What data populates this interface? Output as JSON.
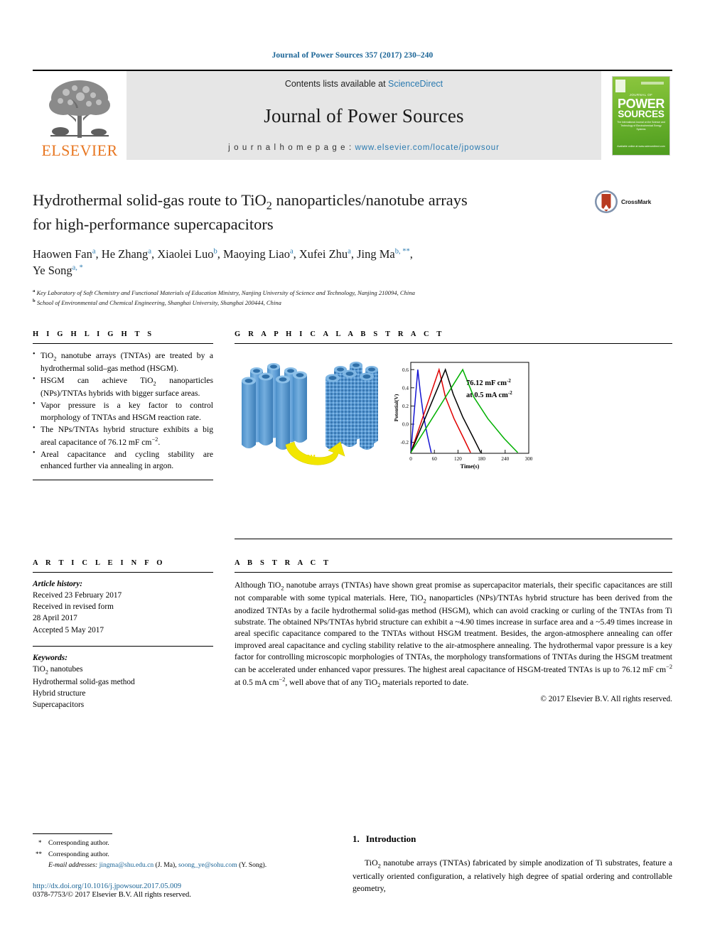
{
  "running_head": "Journal of Power Sources 357 (2017) 230–240",
  "masthead": {
    "publisher": "ELSEVIER",
    "contents_prefix": "Contents lists available at ",
    "contents_link": "ScienceDirect",
    "journal_name": "Journal of Power Sources",
    "homepage_prefix": "j o u r n a l   h o m e p a g e :  ",
    "homepage_url": "www.elsevier.com/locate/jpowsour",
    "cover": {
      "supertitle": "JOURNAL OF",
      "line1": "POWER",
      "line2": "SOURCES",
      "subtitle": "The International Journal on the Science and Technology of Electrochemical Energy Systems",
      "footer": "Available online at\nwww.sciencedirect.com"
    }
  },
  "article": {
    "title": "Hydrothermal solid-gas route to TiO2 nanoparticles/nanotube arrays for high-performance supercapacitors",
    "title_line1_a": "Hydrothermal solid-gas route to TiO",
    "title_line1_sub": "2",
    "title_line1_b": " nanoparticles/nanotube arrays",
    "title_line2": "for high-performance supercapacitors",
    "crossmark_label": "CrossMark",
    "authors": [
      {
        "name": "Haowen Fan",
        "marks": "a",
        "sep": ", "
      },
      {
        "name": "He Zhang",
        "marks": "a",
        "sep": ", "
      },
      {
        "name": "Xiaolei Luo",
        "marks": "b",
        "sep": ", "
      },
      {
        "name": "Maoying Liao",
        "marks": "a",
        "sep": ", "
      },
      {
        "name": "Xufei Zhu",
        "marks": "a",
        "sep": ", "
      },
      {
        "name": "Jing Ma",
        "marks": "b, **",
        "sep": ", "
      },
      {
        "name": "Ye Song",
        "marks": "a, *",
        "sep": ""
      }
    ],
    "affiliations": [
      {
        "mark": "a",
        "text": "Key Laboratory of Soft Chemistry and Functional Materials of Education Ministry, Nanjing University of Science and Technology, Nanjing 210094, China"
      },
      {
        "mark": "b",
        "text": "School of Environmental and Chemical Engineering, Shanghai University, Shanghai 200444, China"
      }
    ]
  },
  "highlights": {
    "heading": "H I G H L I G H T S",
    "items": [
      "TiO2 nanotube arrays (TNTAs) are treated by a hydrothermal solid–gas method (HSGM).",
      "HSGM can achieve TiO2 nanoparticles (NPs)/TNTAs hybrids with bigger surface areas.",
      "Vapor pressure is a key factor to control morphology of TNTAs and HSGM reaction rate.",
      "The NPs/TNTAs hybrid structure exhibits a big areal capacitance of 76.12 mF cm−2.",
      "Areal capacitance and cycling stability are enhanced further via annealing in argon."
    ]
  },
  "graphical_abstract": {
    "heading": "G R A P H I C A L   A B S T R A C T",
    "arrow_label": "HSGM"
  },
  "chart_data": {
    "type": "line",
    "title": "",
    "xlabel": "Time(s)",
    "ylabel": "Potential(V)",
    "xlim": [
      0,
      300
    ],
    "ylim": [
      -0.32,
      0.68
    ],
    "xticks": [
      0,
      60,
      120,
      180,
      240,
      300
    ],
    "yticks": [
      -0.2,
      0.0,
      0.2,
      0.4,
      0.6
    ],
    "ytick_labels": [
      "-0.2",
      "0.0",
      "0.2",
      "0.4",
      "0.6"
    ],
    "grid": false,
    "legend": "none",
    "annotations": [
      {
        "text": "76.12 mF cm",
        "sup": "-2"
      },
      {
        "text": "at 0.5 mA cm",
        "sup": "-2"
      }
    ],
    "series": [
      {
        "name": "blue",
        "color": "#1414d2",
        "points": [
          [
            0,
            -0.3
          ],
          [
            18,
            0.6
          ],
          [
            24,
            0.36
          ],
          [
            32,
            0.1
          ],
          [
            42,
            -0.12
          ],
          [
            52,
            -0.3
          ]
        ]
      },
      {
        "name": "red",
        "color": "#e00000",
        "points": [
          [
            0,
            -0.3
          ],
          [
            72,
            0.6
          ],
          [
            88,
            0.3
          ],
          [
            110,
            0.06
          ],
          [
            135,
            -0.16
          ],
          [
            152,
            -0.3
          ]
        ]
      },
      {
        "name": "black",
        "color": "#000000",
        "points": [
          [
            0,
            -0.3
          ],
          [
            88,
            0.6
          ],
          [
            108,
            0.32
          ],
          [
            132,
            0.08
          ],
          [
            158,
            -0.14
          ],
          [
            178,
            -0.3
          ]
        ]
      },
      {
        "name": "green",
        "color": "#00b000",
        "points": [
          [
            0,
            -0.3
          ],
          [
            132,
            0.6
          ],
          [
            160,
            0.3
          ],
          [
            196,
            0.06
          ],
          [
            238,
            -0.16
          ],
          [
            272,
            -0.3
          ]
        ]
      }
    ]
  },
  "article_info": {
    "heading": "A R T I C L E   I N F O",
    "history_label": "Article history:",
    "history": [
      "Received 23 February 2017",
      "Received in revised form",
      "28 April 2017",
      "Accepted 5 May 2017"
    ],
    "keywords_label": "Keywords:",
    "keywords": [
      "TiO2 nanotubes",
      "Hydrothermal solid-gas method",
      "Hybrid structure",
      "Supercapacitors"
    ]
  },
  "abstract": {
    "heading": "A B S T R A C T",
    "text": "Although TiO2 nanotube arrays (TNTAs) have shown great promise as supercapacitor materials, their specific capacitances are still not comparable with some typical materials. Here, TiO2 nanoparticles (NPs)/TNTAs hybrid structure has been derived from the anodized TNTAs by a facile hydrothermal solid-gas method (HSGM), which can avoid cracking or curling of the TNTAs from Ti substrate. The obtained NPs/TNTAs hybrid structure can exhibit a ~4.90 times increase in surface area and a ~5.49 times increase in areal specific capacitance compared to the TNTAs without HSGM treatment. Besides, the argon-atmosphere annealing can offer improved areal capacitance and cycling stability relative to the air-atmosphere annealing. The hydrothermal vapor pressure is a key factor for controlling microscopic morphologies of TNTAs, the morphology transformations of TNTAs during the HSGM treatment can be accelerated under enhanced vapor pressures. The highest areal capacitance of HSGM-treated TNTAs is up to 76.12 mF cm-2 at 0.5 mA cm-2, well above that of any TiO2 materials reported to date.",
    "copyright": "© 2017 Elsevier B.V. All rights reserved."
  },
  "footnotes": {
    "note1": "Corresponding author.",
    "note2": "Corresponding author.",
    "email_label": "E-mail addresses:",
    "emails": [
      {
        "address": "jingma@shu.edu.cn",
        "who": "(J. Ma)"
      },
      {
        "address": "soong_ye@sohu.com",
        "who": "(Y. Song)"
      }
    ],
    "doi": "http://dx.doi.org/10.1016/j.jpowsour.2017.05.009",
    "issn": "0378-7753/© 2017 Elsevier B.V. All rights reserved."
  },
  "introduction": {
    "number": "1.",
    "heading": "Introduction",
    "paragraph": "TiO2 nanotube arrays (TNTAs) fabricated by simple anodization of Ti substrates, feature a vertically oriented configuration, a relatively high degree of spatial ordering and controllable geometry,"
  },
  "colors": {
    "link": "#1a6496",
    "sciencedirect": "#2a7ab0",
    "elsevier_orange": "#e87722",
    "cover_green": "#6fb52e",
    "tube_blue": "#5b9bd5",
    "arrow_yellow": "#f2e600"
  }
}
